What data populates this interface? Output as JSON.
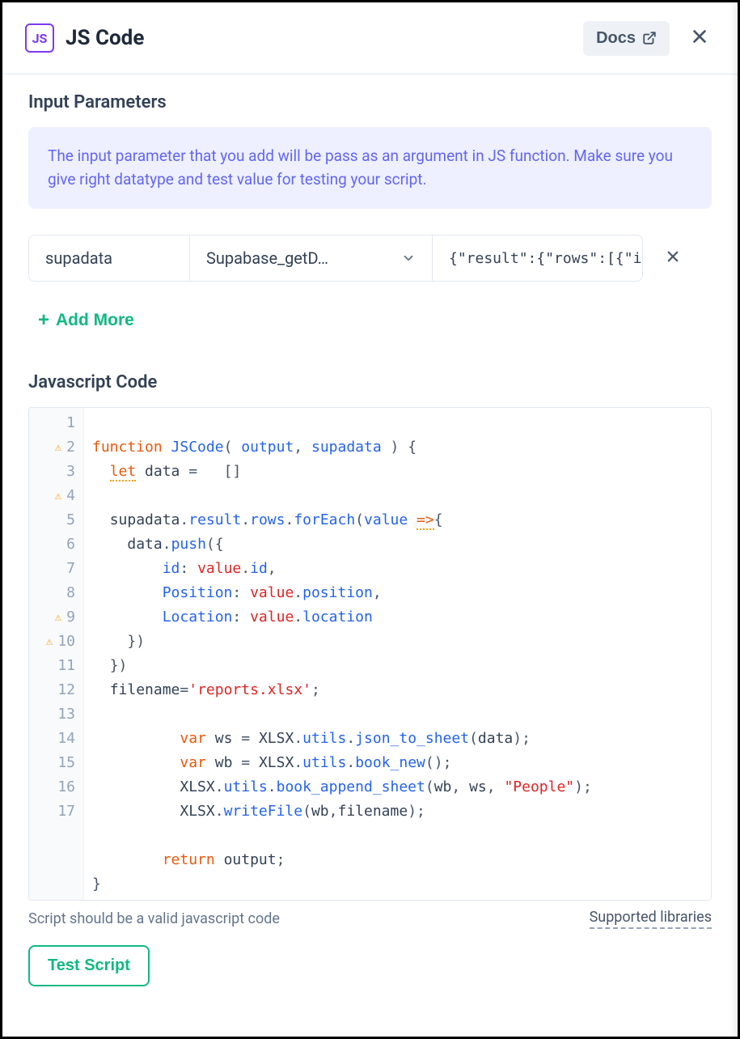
{
  "header": {
    "badge": "JS",
    "title": "JS Code",
    "docs_label": "Docs"
  },
  "sections": {
    "input_params_title": "Input Parameters",
    "info_text": "The input parameter that you add will be pass as an argument in JS function. Make sure you give right datatype and test value for testing your script.",
    "param_name": "supadata",
    "param_source": "Supabase_getD…",
    "param_value": "{\"result\":{\"rows\":[{\"i",
    "add_more_label": "Add More",
    "js_code_title": "Javascript Code",
    "footer_hint": "Script should be a valid javascript code",
    "supported_libs": "Supported libraries",
    "test_btn": "Test Script"
  },
  "code": {
    "lines": [
      {
        "n": 1,
        "warn": false
      },
      {
        "n": 2,
        "warn": true
      },
      {
        "n": 3,
        "warn": false
      },
      {
        "n": 4,
        "warn": true
      },
      {
        "n": 5,
        "warn": false
      },
      {
        "n": 6,
        "warn": false
      },
      {
        "n": 7,
        "warn": false
      },
      {
        "n": 8,
        "warn": false
      },
      {
        "n": 9,
        "warn": true
      },
      {
        "n": 10,
        "warn": true
      },
      {
        "n": 11,
        "warn": false
      },
      {
        "n": 12,
        "warn": false
      },
      {
        "n": 13,
        "warn": false
      },
      {
        "n": 14,
        "warn": false
      },
      {
        "n": 15,
        "warn": false
      },
      {
        "n": 16,
        "warn": false
      },
      {
        "n": 17,
        "warn": false
      }
    ],
    "l1": {
      "kw": "function",
      "name": "JSCode",
      "p1": "output",
      "p2": "supadata"
    },
    "l2": {
      "kw": "let",
      "id": "data",
      "eq": "=",
      "val": "[]"
    },
    "l4": {
      "obj": "supadata",
      "p1": "result",
      "p2": "rows",
      "m": "forEach",
      "arg": "value",
      "arrow": "=>"
    },
    "l5": {
      "obj": "data",
      "m": "push"
    },
    "l6": {
      "key": "id",
      "v": "value",
      "prop": "id"
    },
    "l7": {
      "key": "Position",
      "v": "value",
      "prop": "position"
    },
    "l8": {
      "key": "Location",
      "v": "value",
      "prop": "location"
    },
    "l11": {
      "id": "filename",
      "str": "'reports.xlsx'"
    },
    "l13": {
      "kw": "var",
      "id": "ws",
      "ns": "XLSX",
      "p": "utils",
      "m": "json_to_sheet",
      "arg": "data"
    },
    "l14": {
      "kw": "var",
      "id": "wb",
      "ns": "XLSX",
      "p": "utils",
      "m": "book_new"
    },
    "l15": {
      "ns": "XLSX",
      "p": "utils",
      "m": "book_append_sheet",
      "a1": "wb",
      "a2": "ws",
      "str": "\"People\""
    },
    "l16": {
      "ns": "XLSX",
      "m": "writeFile",
      "a1": "wb",
      "a2": "filename"
    },
    "ret": {
      "kw": "return",
      "id": "output"
    }
  }
}
